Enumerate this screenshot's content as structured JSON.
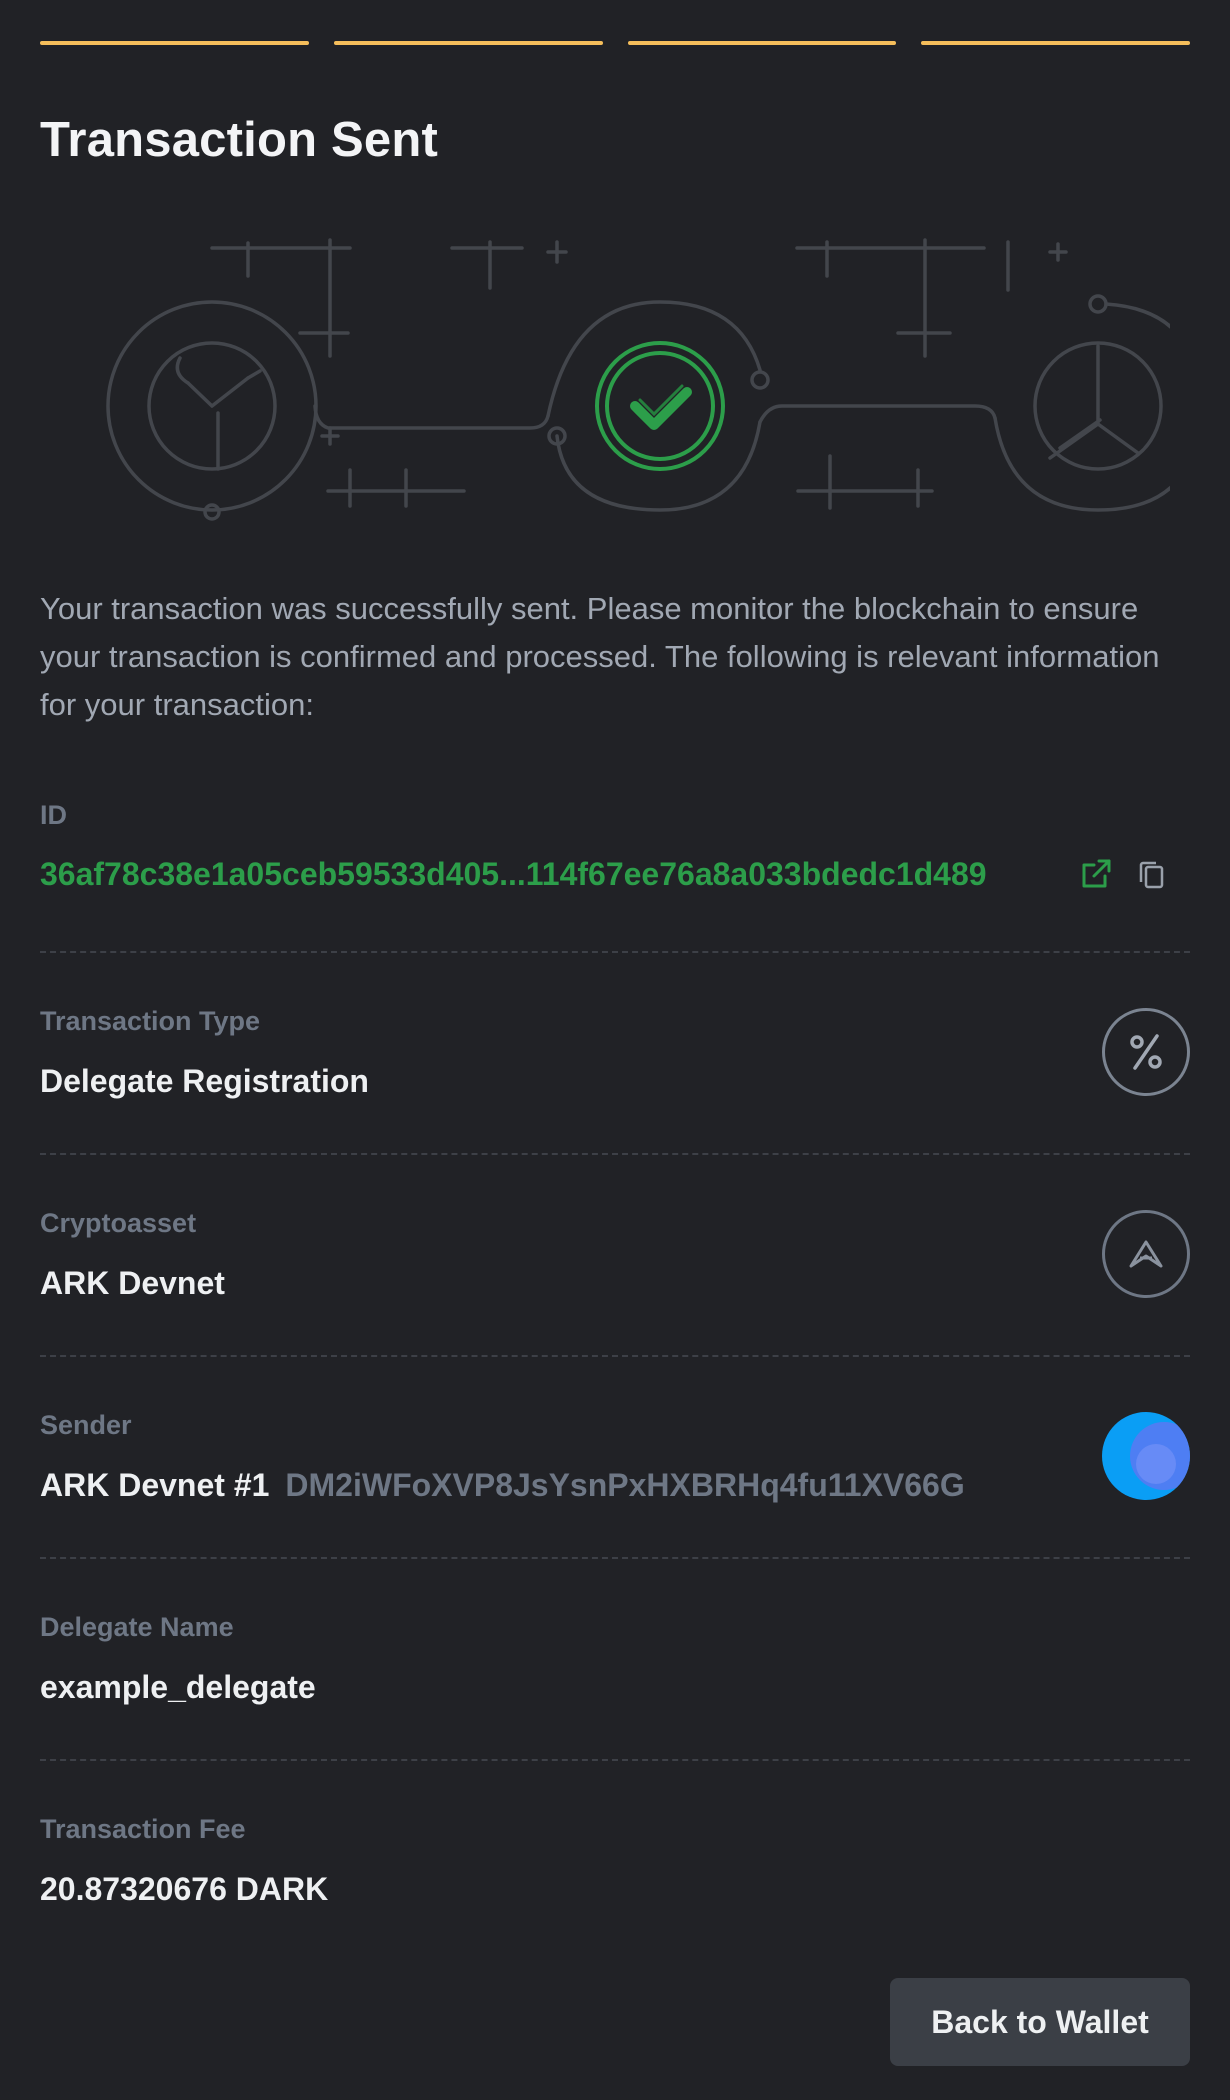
{
  "steps": {
    "count": 4,
    "completed": 4
  },
  "title": "Transaction Sent",
  "description": "Your transaction was successfully sent. Please monitor the blockchain to ensure your transaction is confirmed and processed. The following is relevant information for your transaction:",
  "id_section": {
    "label": "ID",
    "value": "36af78c38e1a05ceb59533d405...114f67ee76a8a033bdedc1d489",
    "icons": [
      "external-link-icon",
      "copy-icon"
    ]
  },
  "transaction_type": {
    "label": "Transaction Type",
    "value": "Delegate Registration",
    "icon": "percent-icon"
  },
  "cryptoasset": {
    "label": "Cryptoasset",
    "value": "ARK Devnet",
    "icon": "ark-logo-icon"
  },
  "sender": {
    "label": "Sender",
    "name": "ARK Devnet #1",
    "address": "DM2iWFoXVP8JsYsnPxHXBRHq4fu11XV66G"
  },
  "delegate_name": {
    "label": "Delegate Name",
    "value": "example_delegate"
  },
  "transaction_fee": {
    "label": "Transaction Fee",
    "value": "20.87320676 DARK"
  },
  "back_button": {
    "label": "Back to Wallet"
  },
  "colors": {
    "background": "#212226",
    "accent_step": "#f5be5b",
    "success_green": "#2c9e4a",
    "muted_text": "#6e7785",
    "button_bg": "#3b3f46"
  }
}
